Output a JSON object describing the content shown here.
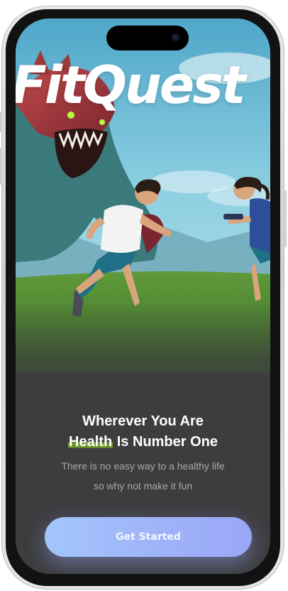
{
  "app": {
    "brand_name": "FitQuest"
  },
  "onboarding": {
    "headline_line1": "Wherever You Are",
    "headline_highlight": "Health",
    "headline_line2_rest": " Is Number One",
    "subtext_line1": "There is no easy way to a healthy life",
    "subtext_line2": "so why not make it fun",
    "cta_label": "Get Started"
  },
  "colors": {
    "background": "#3d3d3f",
    "highlight": "#6f9a2a",
    "cta_start": "#a3c6fb",
    "cta_end": "#9aa6f6",
    "subtext": "#a8a8ab"
  }
}
